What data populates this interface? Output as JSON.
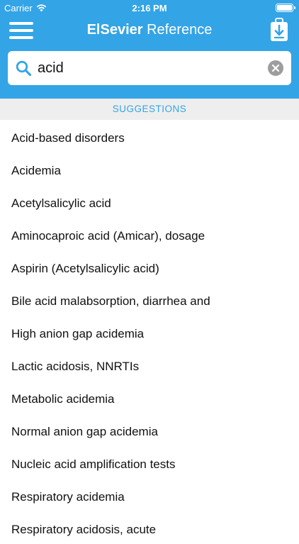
{
  "status_bar": {
    "carrier": "Carrier",
    "time": "2:16 PM",
    "battery_level": 1.0
  },
  "nav": {
    "title_bold": "ElSevier",
    "title_regular": "Reference",
    "menu_icon": "hamburger-menu-icon",
    "download_icon": "download-icon"
  },
  "search": {
    "value": "acid",
    "placeholder": "",
    "search_icon": "search-icon",
    "clear_icon": "clear-icon"
  },
  "suggestions": {
    "header": "SUGGESTIONS",
    "items": [
      "Acid-based disorders",
      "Acidemia",
      "Acetylsalicylic acid",
      "Aminocaproic acid (Amicar), dosage",
      "Aspirin (Acetylsalicylic acid)",
      "Bile acid malabsorption, diarrhea and",
      "High anion gap acidemia",
      "Lactic acidosis, NNRTIs",
      "Metabolic acidemia",
      "Normal anion gap acidemia",
      "Nucleic acid amplification tests",
      "Respiratory acidemia",
      "Respiratory acidosis, acute"
    ]
  },
  "colors": {
    "accent": "#33a4e6",
    "section_background": "#eeeeee",
    "clear_button": "#9d9d9d"
  }
}
